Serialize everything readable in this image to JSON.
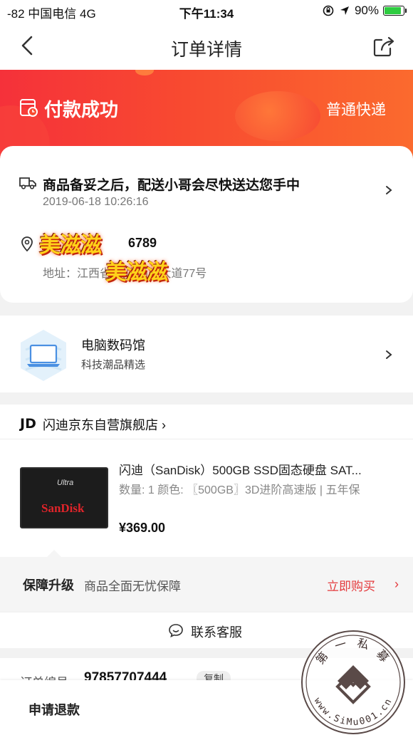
{
  "status_bar": {
    "carrier": "-82 中国电信  4G",
    "time": "下午11:34",
    "battery": "90%",
    "battery_level": 0.9
  },
  "nav": {
    "title": "订单详情"
  },
  "header": {
    "status": "付款成功",
    "shipping": "普通快递"
  },
  "delivery": {
    "message": "商品备妥之后，配送小哥会尽快送达您手中",
    "time": "2019-06-18 10:26:16",
    "name_overlay": "美滋滋",
    "phone": "6789",
    "address": "地址：江西省                         城内西环大道77号",
    "address_overlay": "美滋滋"
  },
  "store_info": {
    "name": "电脑数码馆",
    "subtitle": "科技潮品精选"
  },
  "shop": {
    "logo": "JD",
    "name": "闪迪京东自营旗舰店 ›",
    "product": {
      "name": "闪迪（SanDisk）500GB SSD固态硬盘 SAT...",
      "spec": "数量: 1  颜色: 〖500GB〗3D进阶高速版 | 五年保",
      "price": "¥369.00",
      "thumb_brand": "SanDisk",
      "thumb_series": "Ultra"
    },
    "guarantee": {
      "title": "保障升级",
      "desc": "商品全面无忧保障",
      "action": "立即购买",
      "chevron": "›"
    }
  },
  "contact": {
    "label": "联系客服"
  },
  "order": {
    "label": "订单编号:",
    "number": "97857707444",
    "copy": "复制"
  },
  "bottom": {
    "refund": "申请退款"
  },
  "watermark": {
    "text_top": "第 一 私 募",
    "text_bottom": "www.SiMu001.cn"
  },
  "colors": {
    "accent_red": "#e4393c",
    "header_start": "#f5313a",
    "header_end": "#fb6a2e"
  }
}
